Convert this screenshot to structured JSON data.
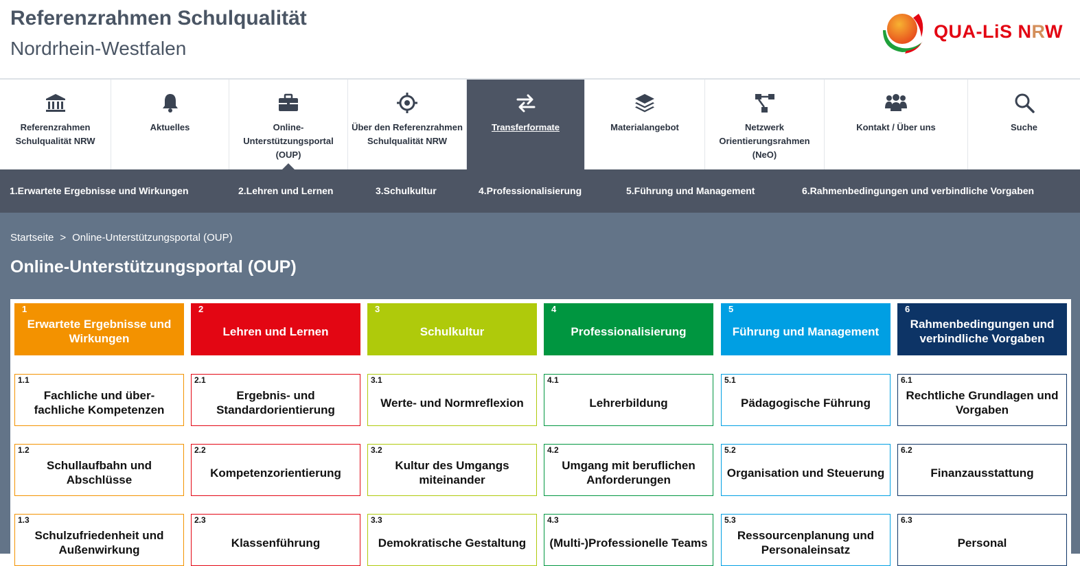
{
  "header": {
    "title": "Referenzrahmen Schulqualität",
    "subtitle": "Nordrhein-Westfalen",
    "logo": {
      "part1": "QUA-",
      "part2": "LiS",
      "part3": " N",
      "part4": "R",
      "part5": "W"
    }
  },
  "mainnav": [
    {
      "label": "Referenzrahmen Schulqualität NRW",
      "icon": "institution-icon",
      "active": false
    },
    {
      "label": "Aktuelles",
      "icon": "bell-icon",
      "active": false
    },
    {
      "label": "Online-Unterstützungsportal (OUP)",
      "icon": "briefcase-icon",
      "active": false
    },
    {
      "label": "Über den Referenzrahmen Schulqualität NRW",
      "icon": "crosshair-icon",
      "active": false
    },
    {
      "label": "Transferformate",
      "icon": "exchange-arrows-icon",
      "active": true
    },
    {
      "label": "Materialangebot",
      "icon": "layers-icon",
      "active": false
    },
    {
      "label": "Netzwerk Orientierungsrahmen (NeO)",
      "icon": "network-icon",
      "active": false
    },
    {
      "label": "Kontakt / Über uns",
      "icon": "people-icon",
      "active": false
    },
    {
      "label": "Suche",
      "icon": "search-icon",
      "active": false
    }
  ],
  "subnav": [
    "1.Erwartete Ergebnisse und Wirkungen",
    "2.Lehren und Lernen",
    "3.Schulkultur",
    "4.Professionalisierung",
    "5.Führung und Management",
    "6.Rahmenbedingungen und verbindliche Vorgaben"
  ],
  "breadcrumb": {
    "home": "Startseite",
    "separator": ">",
    "current": "Online-Unterstützungsportal (OUP)"
  },
  "page_heading": "Online-Unterstützungsportal (OUP)",
  "colors": {
    "orange": "#f39200",
    "red": "#e30613",
    "lime": "#afca0b",
    "green": "#009640",
    "blue": "#009fe3",
    "navy": "#0d3466",
    "nav_dark": "#4d5564",
    "content_bg": "#637488"
  },
  "columns": [
    {
      "num": "1",
      "title": "Erwartete Ergebnisse und Wirkungen",
      "color": "#f39200",
      "items": [
        {
          "num": "1.1",
          "title": "Fachliche und über-fachliche Kompetenzen"
        },
        {
          "num": "1.2",
          "title": "Schullaufbahn und Abschlüsse"
        },
        {
          "num": "1.3",
          "title": "Schulzufriedenheit und Außenwirkung"
        }
      ]
    },
    {
      "num": "2",
      "title": "Lehren und Lernen",
      "color": "#e30613",
      "items": [
        {
          "num": "2.1",
          "title": "Ergebnis- und Standardorientierung"
        },
        {
          "num": "2.2",
          "title": "Kompetenzorientierung"
        },
        {
          "num": "2.3",
          "title": "Klassenführung"
        }
      ]
    },
    {
      "num": "3",
      "title": "Schulkultur",
      "color": "#afca0b",
      "items": [
        {
          "num": "3.1",
          "title": "Werte- und Normreflexion"
        },
        {
          "num": "3.2",
          "title": "Kultur des Umgangs miteinander"
        },
        {
          "num": "3.3",
          "title": "Demokratische Gestaltung"
        }
      ]
    },
    {
      "num": "4",
      "title": "Professionalisierung",
      "color": "#009640",
      "items": [
        {
          "num": "4.1",
          "title": "Lehrerbildung"
        },
        {
          "num": "4.2",
          "title": "Umgang mit beruflichen Anforderungen"
        },
        {
          "num": "4.3",
          "title": "(Multi-)Professionelle Teams"
        }
      ]
    },
    {
      "num": "5",
      "title": "Führung und Management",
      "color": "#009fe3",
      "items": [
        {
          "num": "5.1",
          "title": "Pädagogische Führung"
        },
        {
          "num": "5.2",
          "title": "Organisation und Steuerung"
        },
        {
          "num": "5.3",
          "title": "Ressourcenplanung und Personaleinsatz"
        }
      ]
    },
    {
      "num": "6",
      "title": "Rahmenbedingungen und verbindliche Vorgaben",
      "color": "#0d3466",
      "items": [
        {
          "num": "6.1",
          "title": "Rechtliche Grundlagen und Vorgaben"
        },
        {
          "num": "6.2",
          "title": "Finanzausstattung"
        },
        {
          "num": "6.3",
          "title": "Personal"
        }
      ]
    }
  ]
}
